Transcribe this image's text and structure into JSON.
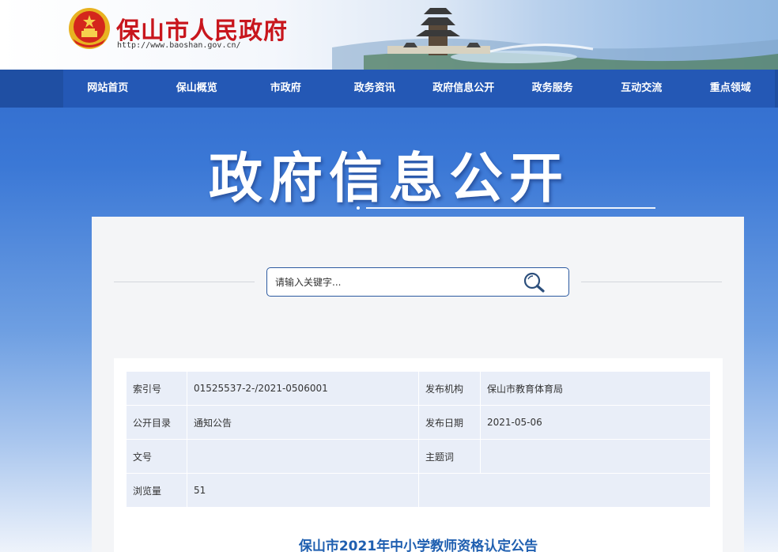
{
  "header": {
    "site_title": "保山市人民政府",
    "site_url": "http://www.baoshan.gov.cn/"
  },
  "nav": {
    "items": [
      "网站首页",
      "保山概览",
      "市政府",
      "政务资讯",
      "政府信息公开",
      "政务服务",
      "互动交流",
      "重点领域"
    ]
  },
  "banner": {
    "title": "政府信息公开"
  },
  "search": {
    "placeholder": "请输入关键字..."
  },
  "meta": {
    "index_label": "索引号",
    "index_value": "01525537-2-/2021-0506001",
    "publisher_label": "发布机构",
    "publisher_value": "保山市教育体育局",
    "catalog_label": "公开目录",
    "catalog_value": "通知公告",
    "date_label": "发布日期",
    "date_value": "2021-05-06",
    "docno_label": "文号",
    "docno_value": "",
    "subject_label": "主题词",
    "subject_value": "",
    "views_label": "浏览量",
    "views_value": "51"
  },
  "article": {
    "title": "保山市2021年中小学教师资格认定公告"
  },
  "colors": {
    "nav_bg": "#2458b5",
    "title_red": "#c8161d",
    "article_blue": "#1f5fb0"
  }
}
